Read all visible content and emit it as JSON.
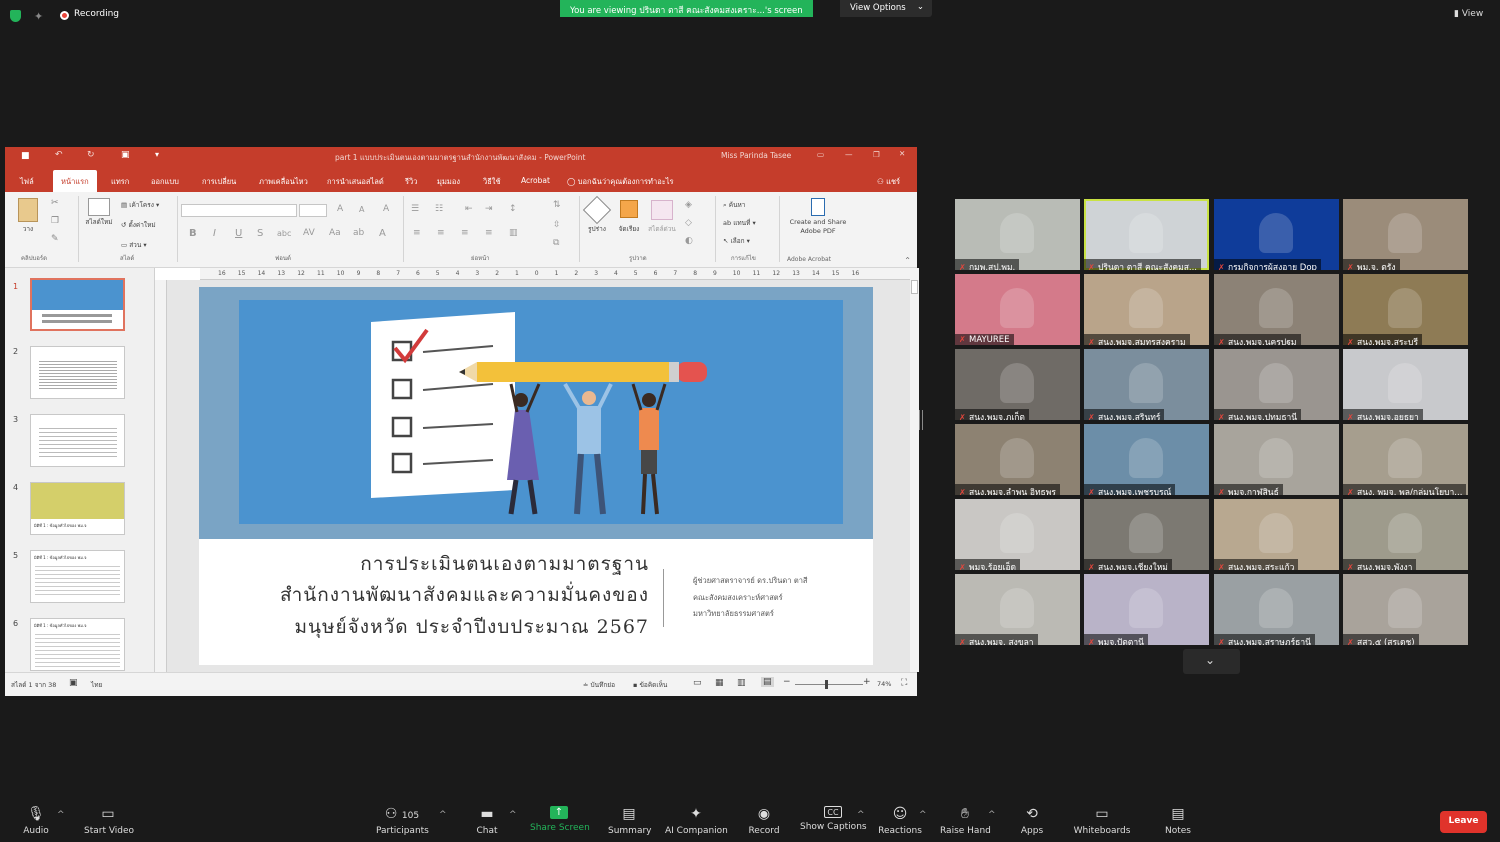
{
  "topbar": {
    "recording_label": "Recording",
    "viewing_banner": "You are viewing ปรินดา ตาสี คณะสังคมสงเคราะ...'s screen",
    "view_options_label": "View Options",
    "view_label": "View"
  },
  "ppt": {
    "window_title": "part 1 แบบประเมินตนเองตามมาตรฐานสำนักงานพัฒนาสังคม - PowerPoint",
    "user_name": "Miss Parinda Tasee",
    "tabs": [
      "ไฟล์",
      "หน้าแรก",
      "แทรก",
      "ออกแบบ",
      "การเปลี่ยน",
      "ภาพเคลื่อนไหว",
      "การนำเสนอสไลด์",
      "รีวิว",
      "มุมมอง",
      "วิธีใช้",
      "Acrobat"
    ],
    "tell_me": "บอกฉันว่าคุณต้องการทำอะไร",
    "share": "แชร์",
    "ribbon": {
      "groups": [
        "คลิปบอร์ด",
        "สไลด์",
        "ฟอนต์",
        "ย่อหน้า",
        "รูปวาด",
        "การแก้ไข",
        "Adobe Acrobat"
      ],
      "paste": "วาง",
      "new_slide": "สไลด์ใหม่",
      "layout": "เค้าโครง",
      "reset": "ตั้งค่าใหม่",
      "section": "ส่วน",
      "shapes": "รูปร่าง",
      "arrange": "จัดเรียง",
      "quick_styles": "สไตล์ด่วน",
      "find": "ค้นหา",
      "replace": "แทนที่",
      "select": "เลือก",
      "acrobat_button": "Create and Share Adobe PDF"
    },
    "ruler_ticks": [
      "16",
      "15",
      "14",
      "13",
      "12",
      "11",
      "10",
      "9",
      "8",
      "7",
      "6",
      "5",
      "4",
      "3",
      "2",
      "1",
      "0",
      "1",
      "2",
      "3",
      "4",
      "5",
      "6",
      "7",
      "8",
      "9",
      "10",
      "11",
      "12",
      "13",
      "14",
      "15",
      "16"
    ],
    "thumbnails": [
      {
        "num": "1"
      },
      {
        "num": "2"
      },
      {
        "num": "3"
      },
      {
        "num": "4"
      },
      {
        "num": "5"
      },
      {
        "num": "6"
      }
    ],
    "thumb_captions": {
      "t4": "มิติที่ 1 : ข้อมูลทั่วไปของ พม.จ",
      "t5": "มิติที่ 1 : ข้อมูลทั่วไปของ พม.จ",
      "t6": "มิติที่ 1 : ข้อมูลทั่วไปของ พม.จ"
    },
    "slide": {
      "title_lines": [
        "การประเมินตนเองตามมาตรฐาน",
        "สำนักงานพัฒนาสังคมและความมั่นคงของ",
        "มนุษย์จังหวัด ประจำปีงบประมาณ 2567"
      ],
      "author_lines": [
        "ผู้ช่วยศาสตราจารย์ ดร.ปรินดา ตาสี",
        "คณะสังคมสงเคราะห์ศาสตร์",
        "มหาวิทยาลัยธรรมศาสตร์"
      ]
    },
    "status": {
      "slide_count": "สไลด์ 1 จาก 38",
      "language": "ไทย",
      "notes": "บันทึกย่อ",
      "comments": "ข้อคิดเห็น",
      "zoom": "74%"
    }
  },
  "gallery": [
    {
      "name": "กมพ.สป.พม.",
      "bg": "#b9bcb6"
    },
    {
      "name": "ปรินดา ตาสี คณะสังคมส...",
      "bg": "#cfd3d6",
      "active": true
    },
    {
      "name": "กรมกิจการผู้สูงอายุ Dop",
      "bg": "#0f3c9a"
    },
    {
      "name": "พม.จ. ตรัง",
      "bg": "#9b8c7a"
    },
    {
      "name": "MAYUREE",
      "bg": "#d47a8a"
    },
    {
      "name": "สนง.พมจ.สมุทรสงคราม",
      "bg": "#b9a48a"
    },
    {
      "name": "สนง.พมจ.นครปฐม",
      "bg": "#8c8276"
    },
    {
      "name": "สนง.พมจ.สระบุรี",
      "bg": "#8e7b55"
    },
    {
      "name": "สนง.พมจ.ภูเก็ต",
      "bg": "#6f6b66"
    },
    {
      "name": "สนง.พมจ.สุรินทร์",
      "bg": "#7b8e9d"
    },
    {
      "name": "สนง.พมจ.ปทุมธานี",
      "bg": "#9a9590"
    },
    {
      "name": "สนง.พมจ.อยุธยา",
      "bg": "#c8c9cc"
    },
    {
      "name": "สนง.พมจ.ลำพูน อิทธพร",
      "bg": "#8d8272"
    },
    {
      "name": "สนง.พมจ.เพชรบูรณ์",
      "bg": "#6c8ea8"
    },
    {
      "name": "พมจ.กาฬสินธุ์",
      "bg": "#a8a49c"
    },
    {
      "name": "สนง. พมจ. พล/กลุ่มนโยบา...",
      "bg": "#a69e8e"
    },
    {
      "name": "พมจ.ร้อยเอ็ด",
      "bg": "#c9c7c4"
    },
    {
      "name": "สนง.พมจ.เชียงใหม่",
      "bg": "#7c7972"
    },
    {
      "name": "สนง.พมจ.สระแก้ว",
      "bg": "#b8a890"
    },
    {
      "name": "สนง.พมจ.พังงา",
      "bg": "#9e9b8c"
    },
    {
      "name": "สนง.พมจ. สงขลา",
      "bg": "#bbbab4"
    },
    {
      "name": "พมจ.ปัตตานี",
      "bg": "#b9b3c8"
    },
    {
      "name": "สนง.พมจ.สุราษฎร์ธานี",
      "bg": "#9aa0a3"
    },
    {
      "name": "สสว.๕ (สรเดช)",
      "bg": "#a9a39b"
    }
  ],
  "toolbar": {
    "audio": "Audio",
    "start_video": "Start Video",
    "participants": "Participants",
    "participants_count": "105",
    "chat": "Chat",
    "share_screen": "Share Screen",
    "summary": "Summary",
    "ai_companion": "AI Companion",
    "record": "Record",
    "show_captions": "Show Captions",
    "reactions": "Reactions",
    "raise_hand": "Raise Hand",
    "apps": "Apps",
    "whiteboards": "Whiteboards",
    "notes": "Notes",
    "leave": "Leave"
  }
}
